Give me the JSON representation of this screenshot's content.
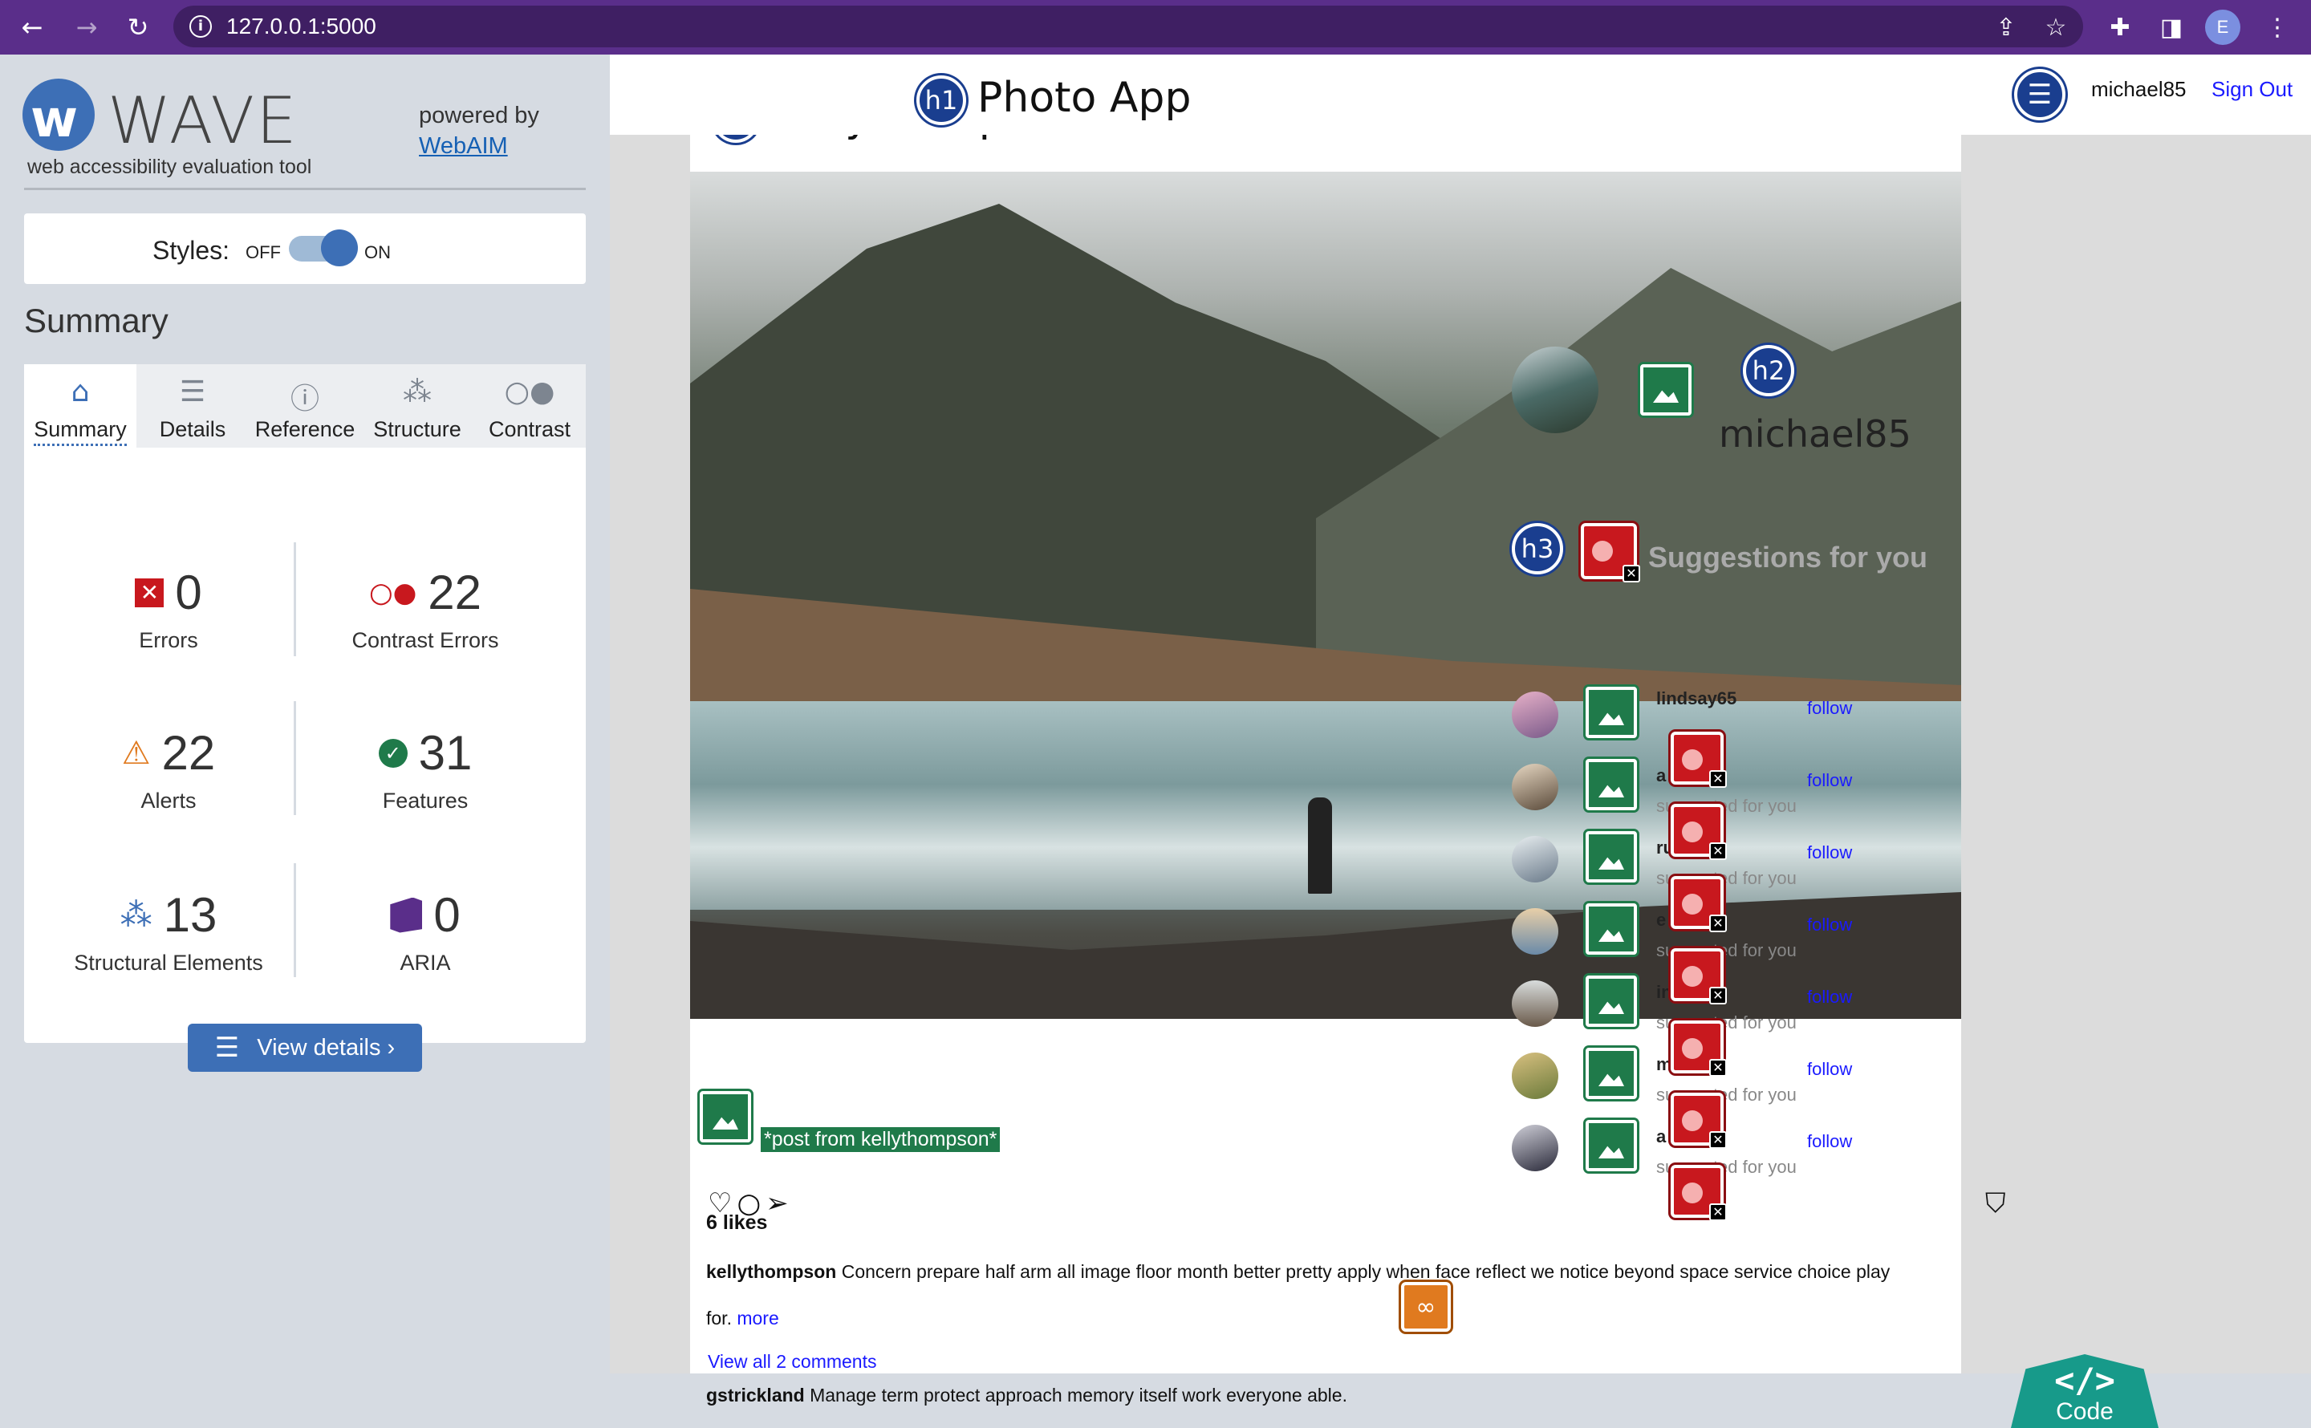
{
  "browser": {
    "url": "127.0.0.1:5000",
    "profile_initial": "E"
  },
  "wave": {
    "logo_text": "WAVE",
    "subtitle": "web accessibility evaluation tool",
    "powered_by": "powered by",
    "webaim": "WebAIM",
    "styles_label": "Styles:",
    "off": "OFF",
    "on": "ON",
    "styles_on": true,
    "summary_title": "Summary",
    "tabs": [
      {
        "label": "Summary",
        "icon": "home-icon"
      },
      {
        "label": "Details",
        "icon": "list-icon"
      },
      {
        "label": "Reference",
        "icon": "info-icon"
      },
      {
        "label": "Structure",
        "icon": "structure-icon"
      },
      {
        "label": "Contrast",
        "icon": "contrast-icon"
      }
    ],
    "stats": {
      "errors": {
        "value": "0",
        "label": "Errors"
      },
      "contrast": {
        "value": "22",
        "label": "Contrast Errors"
      },
      "alerts": {
        "value": "22",
        "label": "Alerts"
      },
      "features": {
        "value": "31",
        "label": "Features"
      },
      "structural": {
        "value": "13",
        "label": "Structural Elements"
      },
      "aria": {
        "value": "0",
        "label": "ARIA"
      }
    },
    "view_details": "View details ›",
    "colors": {
      "accent": "#3d6fb6",
      "error": "#c8181e",
      "alert": "#e07a1f",
      "feature": "#1f7a4a"
    }
  },
  "app": {
    "title": "Photo App",
    "h1": "h1",
    "h2": "h2",
    "h3": "h3",
    "username": "michael85",
    "sign_out": "Sign Out",
    "post_user": "kellythompson",
    "alt_text": "*post from kellythompson*",
    "likes": "6 likes",
    "caption_user": "kellythompson",
    "caption_text": "Concern prepare half arm all image floor month better pretty apply when face reflect we notice beyond space service choice play for.",
    "more": "more",
    "view_all": "View all 2 comments",
    "comment_user": "gstrickland",
    "comment_text": "Manage term protect approach memory itself work everyone able.",
    "side_username": "michael85",
    "suggestions_title": "Suggestions for you",
    "suggestions": [
      {
        "name": "lindsay65",
        "follow": "follow",
        "sub": ""
      },
      {
        "name": "a",
        "follow": "follow",
        "sub": "suggested for you"
      },
      {
        "name": "russell",
        "follow": "follow",
        "sub": "suggested for you"
      },
      {
        "name": "e",
        "follow": "follow",
        "sub": "suggested for you"
      },
      {
        "name": "in",
        "follow": "follow",
        "sub": "suggested for you"
      },
      {
        "name": "m",
        "follow": "follow",
        "sub": "suggested for you"
      },
      {
        "name": "a",
        "follow": "follow",
        "sub": "suggested for you"
      }
    ],
    "code_tab": "Code"
  }
}
